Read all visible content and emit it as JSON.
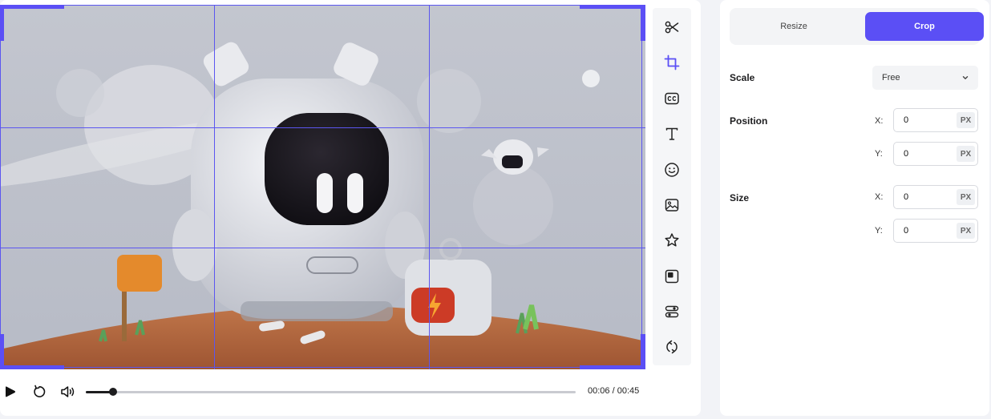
{
  "player": {
    "current_time": "00:06",
    "separator": "/",
    "duration": "00:45",
    "progress_fraction": 0.055,
    "play_icon": "play-icon",
    "replay_icon": "replay-icon",
    "volume_icon": "volume-icon"
  },
  "toolbar": {
    "items": [
      {
        "icon": "scissors-icon"
      },
      {
        "icon": "crop-icon",
        "active": true
      },
      {
        "icon": "captions-icon"
      },
      {
        "icon": "text-icon"
      },
      {
        "icon": "emoji-icon"
      },
      {
        "icon": "image-icon"
      },
      {
        "icon": "star-icon"
      },
      {
        "icon": "overlay-icon"
      },
      {
        "icon": "adjust-icon"
      },
      {
        "icon": "loop-icon"
      }
    ]
  },
  "settings": {
    "tabs": [
      {
        "label": "Resize",
        "active": false
      },
      {
        "label": "Crop",
        "active": true
      }
    ],
    "scale": {
      "label": "Scale",
      "value": "Free"
    },
    "position": {
      "label": "Position",
      "x_label": "X:",
      "x_value": "0",
      "y_label": "Y:",
      "y_value": "0",
      "unit": "PX"
    },
    "size": {
      "label": "Size",
      "x_label": "X:",
      "x_value": "0",
      "y_label": "Y:",
      "y_value": "0",
      "unit": "PX"
    }
  },
  "colors": {
    "accent": "#5b4ff5",
    "grid": "#5b56f0",
    "panel_bg": "#ffffff",
    "page_bg": "#f2f3f7"
  }
}
